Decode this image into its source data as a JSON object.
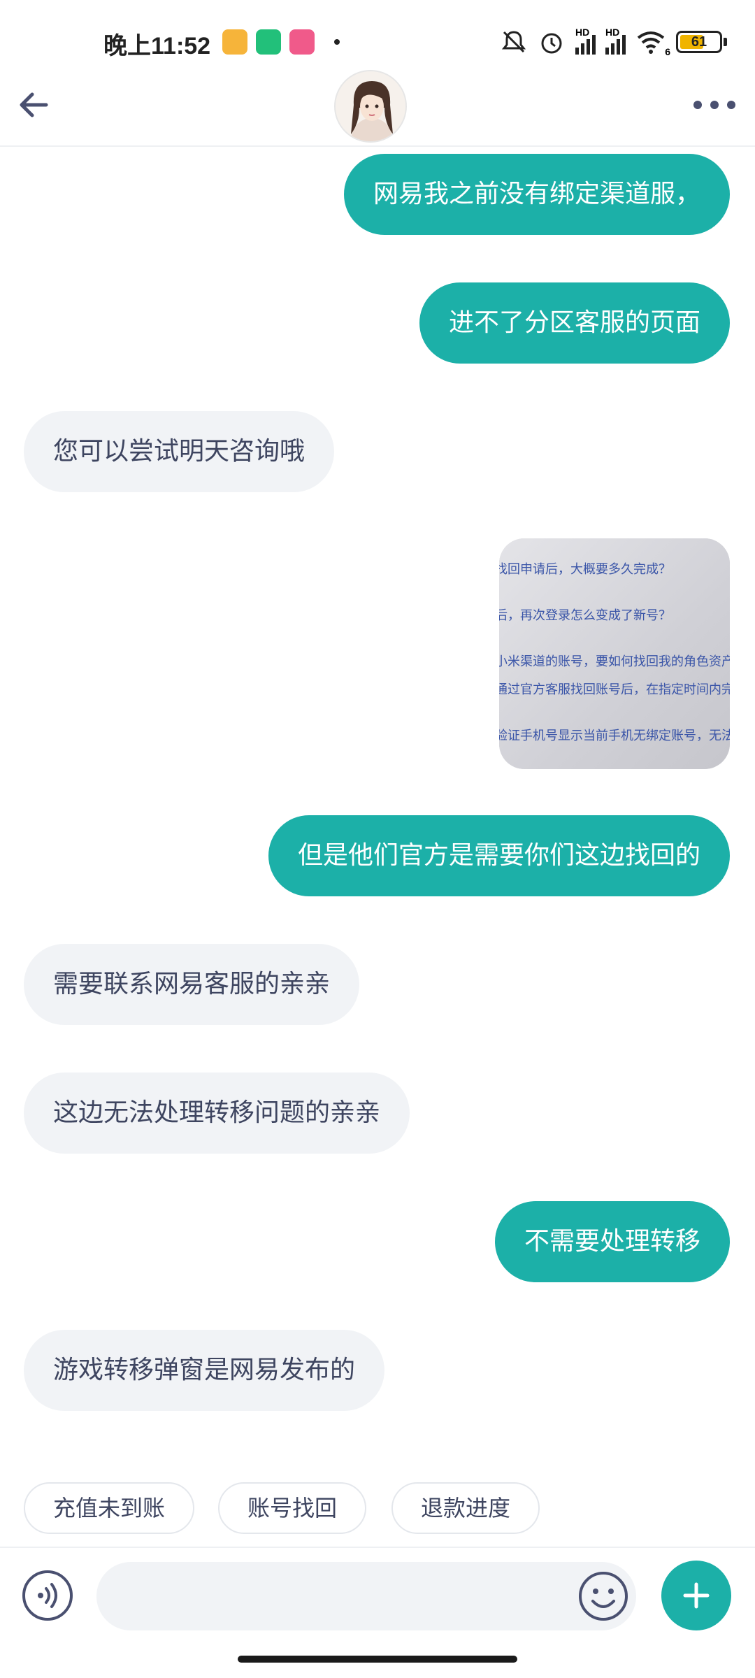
{
  "status_bar": {
    "time": "晚上11:52",
    "battery_level": "61",
    "network_labels": [
      "HD",
      "HD"
    ],
    "wifi_label": "6"
  },
  "header": {
    "back_icon": "arrow-left-icon",
    "more_icon": "more-horizontal-icon"
  },
  "messages": [
    {
      "side": "out",
      "text": "网易我之前没有绑定渠道服，"
    },
    {
      "side": "out",
      "text": "进不了分区客服的页面"
    },
    {
      "side": "in",
      "text": "您可以尝试明天咨询哦"
    },
    {
      "side": "out",
      "type": "image"
    },
    {
      "side": "out",
      "text": "但是他们官方是需要你们这边找回的"
    },
    {
      "side": "in",
      "text": "需要联系网易客服的亲亲"
    },
    {
      "side": "in",
      "text": "这边无法处理转移问题的亲亲"
    },
    {
      "side": "out",
      "text": "不需要处理转移"
    },
    {
      "side": "in",
      "text": "游戏转移弹窗是网易发布的"
    }
  ],
  "image_message": {
    "lines": [
      "找回申请后，大概要多久完成？",
      "后，再次登录怎么变成了新号？",
      "小米渠道的账号，要如何找回我的角色资产",
      "通过官方客服找回账号后，在指定时间内完成渠",
      "验证手机号显示当前手机无绑定账号，无法"
    ]
  },
  "quick_replies": [
    "充值未到账",
    "账号找回",
    "退款进度"
  ],
  "input": {
    "placeholder": "",
    "voice_icon": "voice-icon",
    "emoji_icon": "emoji-icon",
    "plus_icon": "plus-icon"
  },
  "colors": {
    "accent": "#1cb0a8",
    "incoming_bubble": "#f1f3f6",
    "incoming_text": "#3e4560"
  }
}
